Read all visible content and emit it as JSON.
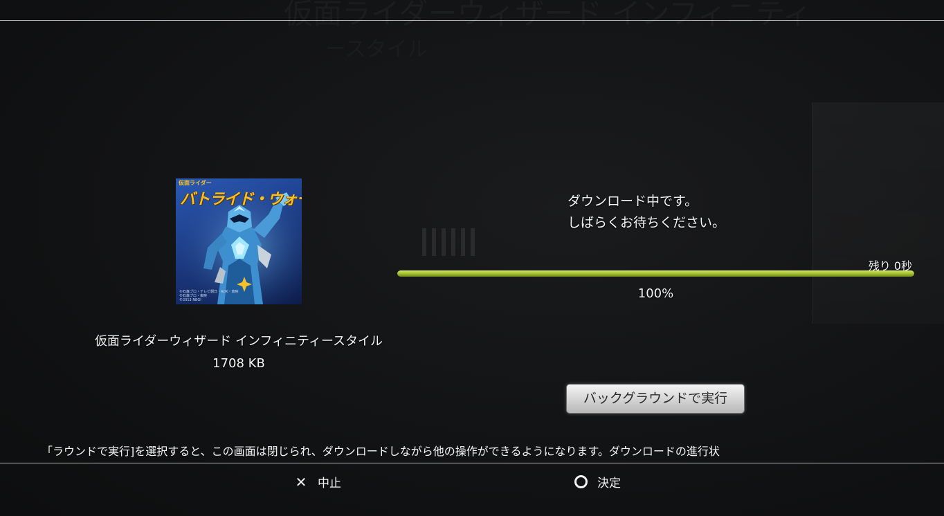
{
  "background_ghost": {
    "title": "仮面ライダーウィザード インフィニティ",
    "subtitle": "ースタイル"
  },
  "content": {
    "thumbnail_title": "バトライド・ウォー",
    "thumbnail_subtitle": "仮面ライダー",
    "name": "仮面ライダーウィザード インフィニティースタイル",
    "size": "1708 KB"
  },
  "status": {
    "line1": "ダウンロード中です。",
    "line2": "しばらくお待ちください。",
    "remaining": "残り 0秒",
    "percent_text": "100%",
    "progress": 1.0,
    "progress_color": "#a9c537"
  },
  "actions": {
    "background_button": "バックグラウンドで実行"
  },
  "ticker": {
    "text": "｢ラウンドで実行]を選択すると、この画面は閉じられ、ダウンロードしながら他の操作ができるようになります。ダウンロードの進行状"
  },
  "footer": {
    "cancel_icon": "cross-icon",
    "cancel_label": "中止",
    "confirm_icon": "circle-icon",
    "confirm_label": "決定"
  }
}
